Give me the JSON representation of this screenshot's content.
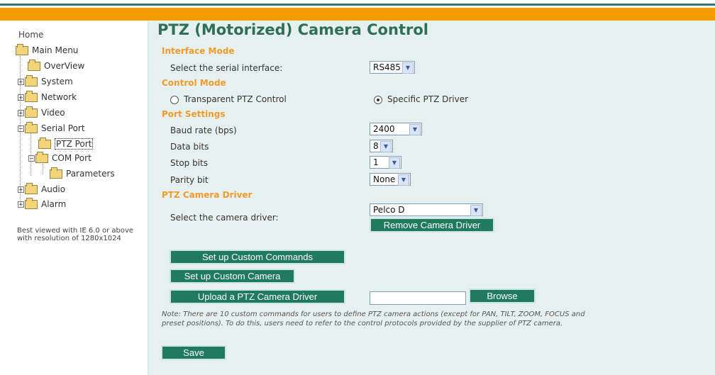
{
  "sidebar": {
    "home": "Home",
    "items": [
      {
        "label": "Main Menu"
      },
      {
        "label": "OverView"
      },
      {
        "label": "System"
      },
      {
        "label": "Network"
      },
      {
        "label": "Video"
      },
      {
        "label": "Serial Port"
      },
      {
        "label": "PTZ Port"
      },
      {
        "label": "COM Port"
      },
      {
        "label": "Parameters"
      },
      {
        "label": "Audio"
      },
      {
        "label": "Alarm"
      }
    ],
    "note": "Best viewed with IE 6.0 or above with resolution of 1280x1024"
  },
  "page": {
    "title": "PTZ (Motorized) Camera Control",
    "interface_mode": {
      "heading": "Interface Mode",
      "label": "Select the serial interface:",
      "value": "RS485"
    },
    "control_mode": {
      "heading": "Control Mode",
      "option1": "Transparent PTZ Control",
      "option2": "Specific PTZ Driver",
      "selected": "Specific PTZ Driver"
    },
    "port_settings": {
      "heading": "Port Settings",
      "baud_label": "Baud rate (bps)",
      "baud_value": "2400",
      "data_bits_label": "Data bits",
      "data_bits_value": "8",
      "stop_bits_label": "Stop bits",
      "stop_bits_value": "1",
      "parity_label": "Parity bit",
      "parity_value": "None"
    },
    "driver": {
      "heading": "PTZ Camera Driver",
      "label": "Select the camera driver:",
      "value": "Pelco D",
      "remove_button": "Remove Camera Driver"
    },
    "buttons": {
      "custom_commands": "Set up Custom Commands",
      "custom_camera": "Set up Custom Camera",
      "upload_driver": "Upload a PTZ Camera Driver",
      "browse": "Browse",
      "save": "Save"
    },
    "note": "Note: There are 10 custom commands for users to define PTZ camera actions (except for PAN, TILT, ZOOM, FOCUS and preset positions). To do this, users need to refer to the control protocols provided by the supplier of PTZ camera."
  },
  "colors": {
    "header_orange": "#f59d00",
    "title_green": "#2f6e58",
    "section_orange": "#f29a2e",
    "button_green": "#1f7a5e",
    "content_bg": "#e6f1ef"
  }
}
